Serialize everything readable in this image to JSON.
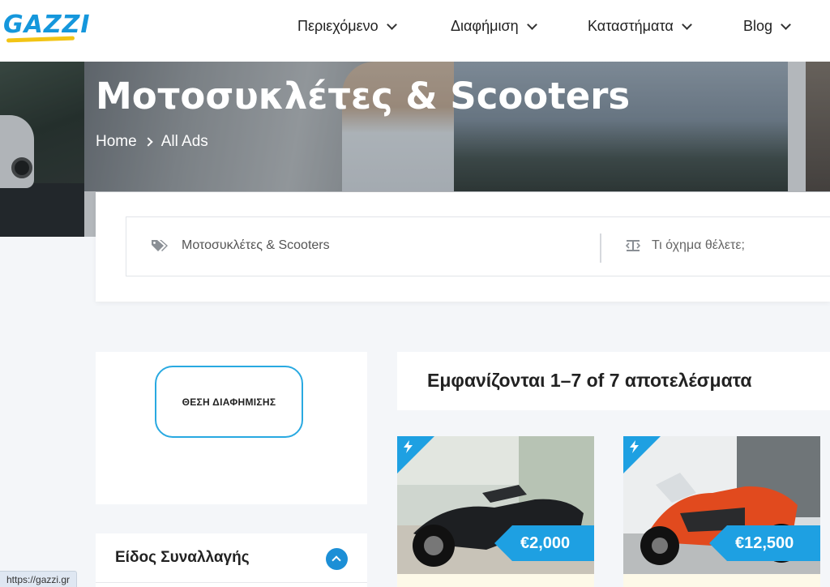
{
  "header": {
    "logo_text": "GAZZI",
    "nav": [
      {
        "label": "Περιεχόμενο"
      },
      {
        "label": "Διαφήμιση"
      },
      {
        "label": "Καταστήματα"
      },
      {
        "label": "Blog"
      }
    ]
  },
  "hero": {
    "title": "Μοτοσυκλέτες & Scooters",
    "breadcrumb": [
      "Home",
      "All Ads"
    ]
  },
  "search": {
    "category_value": "Μοτοσυκλέτες & Scooters",
    "vehicle_placeholder": "Τι όχημα θέλετε;"
  },
  "sidebar": {
    "ad_button_label": "ΘΕΣΗ ΔΙΑΦΗΜΙΣΗΣ",
    "filter_title": "Είδος Συναλλαγής"
  },
  "results": {
    "count_text": "Εμφανίζονται 1–7 of 7 αποτελέσματα",
    "listings": [
      {
        "price": "€2,000",
        "featured": true
      },
      {
        "price": "€12,500",
        "featured": true
      }
    ]
  },
  "status_bar": {
    "url": "https://gazzi.gr"
  },
  "colors": {
    "accent": "#1ea0e2",
    "logo_blue": "#1597dc",
    "logo_yellow": "#f2c414",
    "page_bg": "#f4f6f9"
  }
}
